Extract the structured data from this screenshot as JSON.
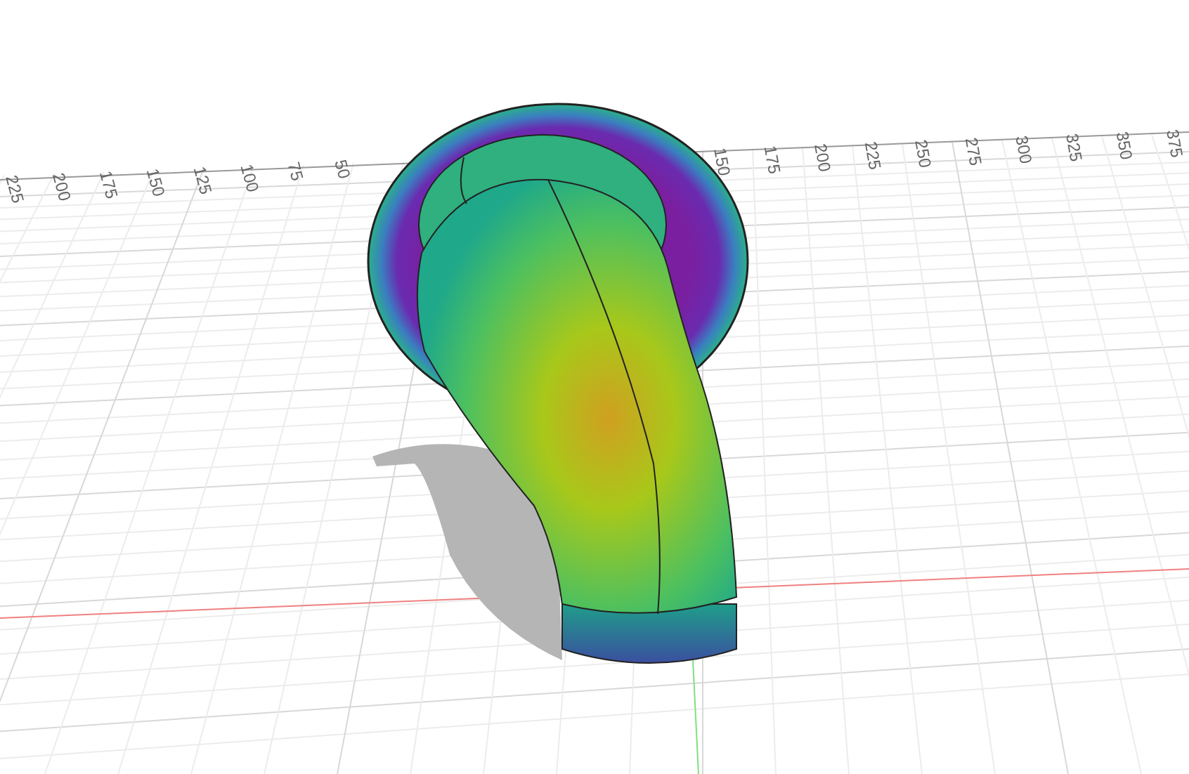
{
  "viewport": {
    "ruler": {
      "left_labels": [
        "225",
        "200",
        "175",
        "150",
        "125",
        "100",
        "75",
        "50"
      ],
      "right_labels": [
        "150",
        "175",
        "200",
        "225",
        "250",
        "275",
        "300",
        "325",
        "350",
        "375"
      ]
    }
  }
}
